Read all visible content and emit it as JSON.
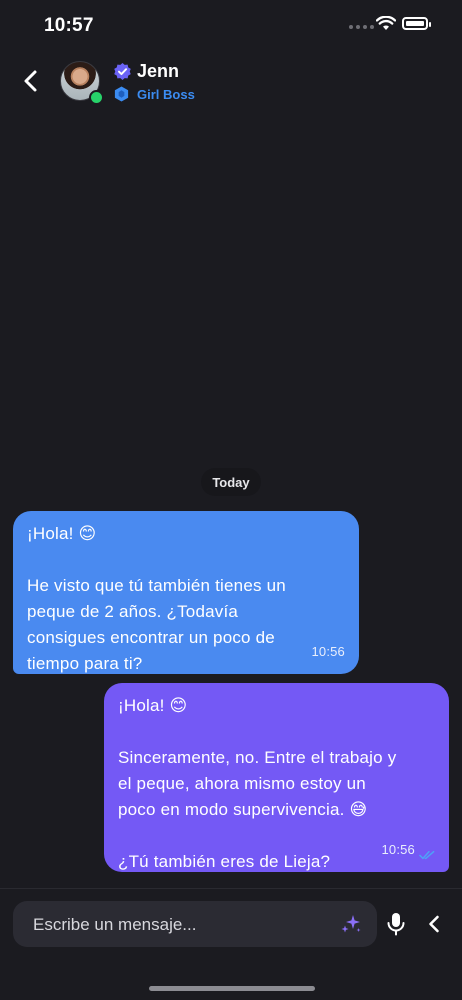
{
  "status_bar": {
    "time": "10:57"
  },
  "contact": {
    "name": "Jenn",
    "role": "Girl Boss",
    "online": true,
    "verified": true
  },
  "chat": {
    "date_separator": "Today",
    "messages": [
      {
        "direction": "incoming",
        "greeting": "¡Hola! 😊",
        "body": [
          "He visto que tú también tienes un",
          "peque de 2 años. ¿Todavía",
          "consigues encontrar un poco de",
          "tiempo para ti?"
        ],
        "time": "10:56"
      },
      {
        "direction": "outgoing",
        "greeting": "¡Hola! 😊",
        "body": [
          "Sinceramente, no. Entre el trabajo y",
          "el peque, ahora mismo estoy un",
          "poco en modo supervivencia. 😅"
        ],
        "question": "¿Tú también eres de Lieja?",
        "time": "10:56",
        "status": "read"
      }
    ]
  },
  "composer": {
    "placeholder": "Escribe un mensaje..."
  },
  "colors": {
    "background": "#1b1b20",
    "incoming_bubble": "#4a8af0",
    "outgoing_bubble": "#7459f5",
    "accent_blue": "#3b8cf2",
    "online": "#27d36a",
    "sparkle": "#8b6ff7"
  },
  "icons": [
    "back-arrow-icon",
    "verified-badge-icon",
    "role-badge-icon",
    "sparkle-icon",
    "microphone-icon",
    "chevron-left-icon",
    "wifi-icon",
    "battery-icon",
    "double-check-icon"
  ]
}
